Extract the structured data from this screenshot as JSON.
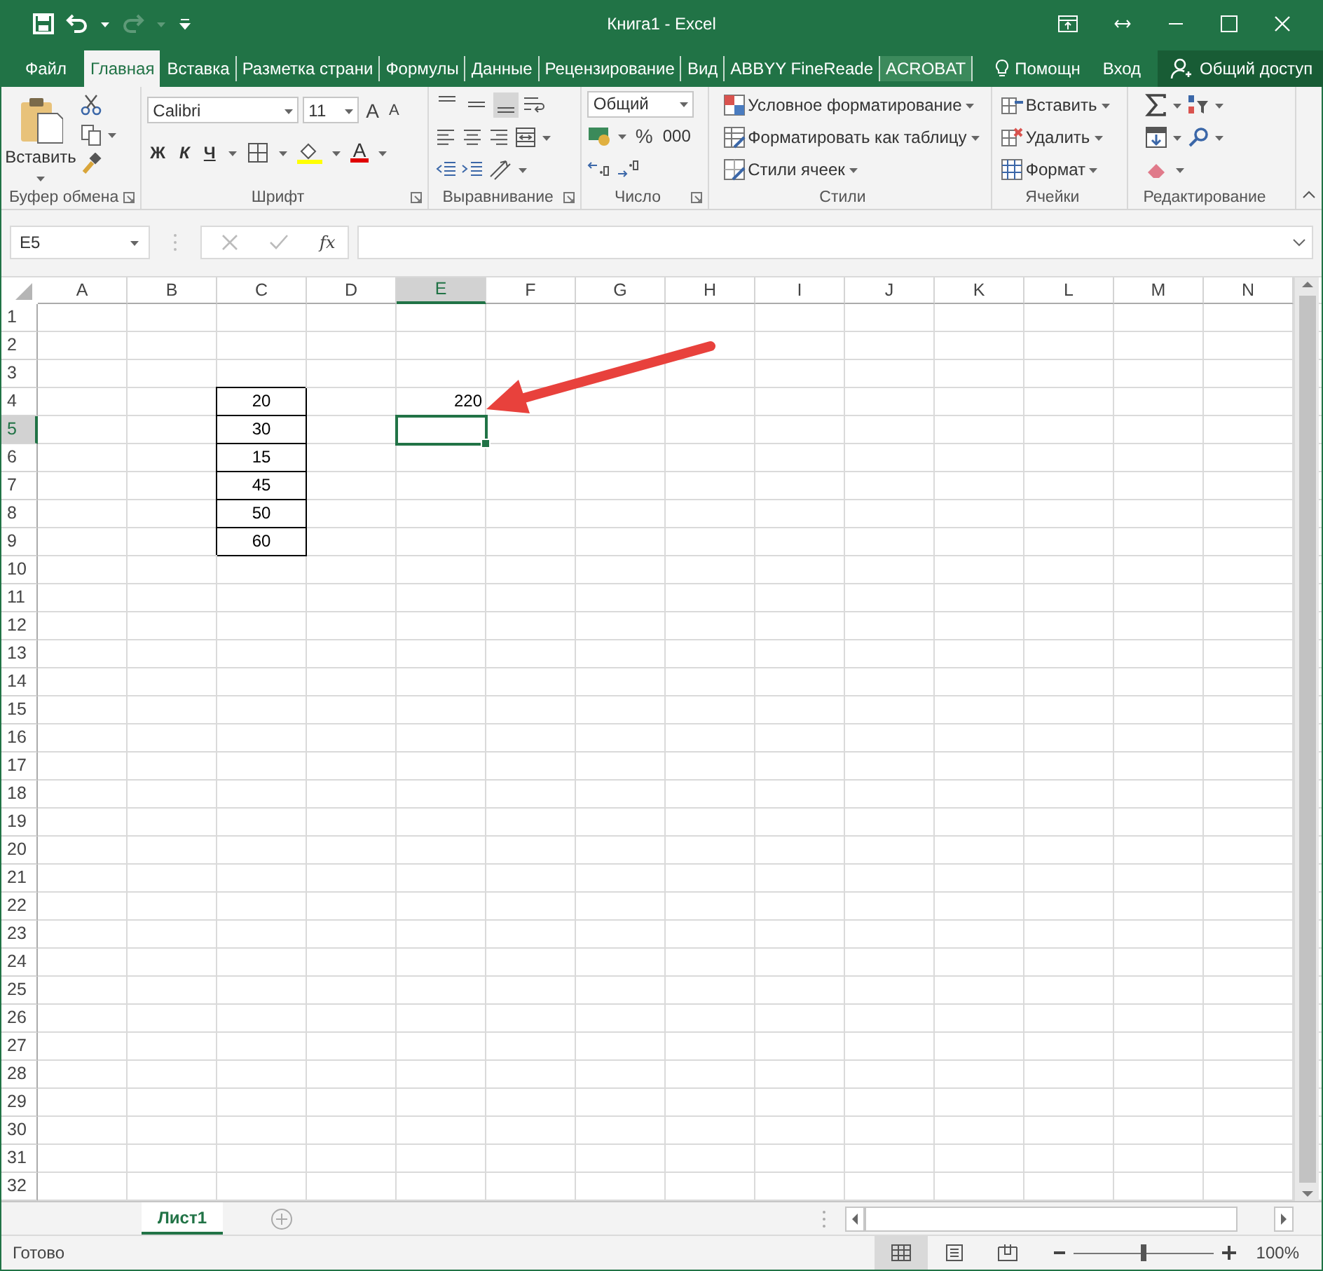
{
  "title_bar": {
    "title": "Книга1 - Excel"
  },
  "ribbon_tabs": [
    {
      "label": "Файл",
      "selected": false,
      "hovered": false
    },
    {
      "label": "Главная",
      "selected": true,
      "hovered": false
    },
    {
      "label": "Вставка",
      "selected": false,
      "hovered": false
    },
    {
      "label": "Разметка страни",
      "selected": false,
      "hovered": false
    },
    {
      "label": "Формулы",
      "selected": false,
      "hovered": false
    },
    {
      "label": "Данные",
      "selected": false,
      "hovered": false
    },
    {
      "label": "Рецензирование",
      "selected": false,
      "hovered": false
    },
    {
      "label": "Вид",
      "selected": false,
      "hovered": false
    },
    {
      "label": "ABBYY FineReade",
      "selected": false,
      "hovered": false
    },
    {
      "label": "ACROBAT",
      "selected": false,
      "hovered": true
    }
  ],
  "tell_me": {
    "label": "Помощн"
  },
  "sign_in": {
    "label": "Вход"
  },
  "share": {
    "label": "Общий доступ"
  },
  "ribbon": {
    "groups": [
      {
        "kind": "clipboard",
        "label": "Буфер обмена",
        "paste": "Вставить"
      },
      {
        "kind": "font",
        "label": "Шрифт",
        "font_name": "Calibri",
        "font_size": "11",
        "grow": "A",
        "shrink": "A",
        "bold": "Ж",
        "italic": "К",
        "underline": "Ч",
        "font_color": "A"
      },
      {
        "kind": "alignment",
        "label": "Выравнивание"
      },
      {
        "kind": "number",
        "label": "Число",
        "format": "Общий",
        "percent": "%",
        "thousands": "000"
      },
      {
        "kind": "styles",
        "label": "Стили",
        "items": [
          "Условное форматирование",
          "Форматировать как таблицу",
          "Стили ячеек"
        ]
      },
      {
        "kind": "cells",
        "label": "Ячейки",
        "items": [
          "Вставить",
          "Удалить",
          "Формат"
        ]
      },
      {
        "kind": "editing",
        "label": "Редактирование"
      }
    ]
  },
  "formula_bar": {
    "name_box": "E5",
    "function_label": "fx"
  },
  "sheet": {
    "columns": [
      {
        "label": "A",
        "selected": false
      },
      {
        "label": "B",
        "selected": false
      },
      {
        "label": "C",
        "selected": false
      },
      {
        "label": "D",
        "selected": false
      },
      {
        "label": "E",
        "selected": true
      },
      {
        "label": "F",
        "selected": false
      },
      {
        "label": "G",
        "selected": false
      },
      {
        "label": "H",
        "selected": false
      },
      {
        "label": "I",
        "selected": false
      },
      {
        "label": "J",
        "selected": false
      },
      {
        "label": "K",
        "selected": false
      },
      {
        "label": "L",
        "selected": false
      },
      {
        "label": "M",
        "selected": false
      },
      {
        "label": "N",
        "selected": false
      }
    ],
    "rows": [
      {
        "header": "1",
        "selected": false
      },
      {
        "header": "2",
        "selected": false
      },
      {
        "header": "3",
        "selected": false
      },
      {
        "header": "4",
        "selected": false,
        "cells": {
          "C": {
            "value": "20",
            "centered": true,
            "bordered": true
          },
          "E": {
            "value": "220",
            "centered": false,
            "bordered": false
          }
        }
      },
      {
        "header": "5",
        "selected": true,
        "cells": {
          "C": {
            "value": "30",
            "centered": true,
            "bordered": true
          },
          "E": {
            "selected": true
          }
        }
      },
      {
        "header": "6",
        "selected": false,
        "cells": {
          "C": {
            "value": "15",
            "centered": true,
            "bordered": true
          }
        }
      },
      {
        "header": "7",
        "selected": false,
        "cells": {
          "C": {
            "value": "45",
            "centered": true,
            "bordered": true
          }
        }
      },
      {
        "header": "8",
        "selected": false,
        "cells": {
          "C": {
            "value": "50",
            "centered": true,
            "bordered": true
          }
        }
      },
      {
        "header": "9",
        "selected": false,
        "cells": {
          "C": {
            "value": "60",
            "centered": true,
            "bordered": true
          }
        }
      },
      {
        "header": "10",
        "selected": false
      },
      {
        "header": "11",
        "selected": false
      },
      {
        "header": "12",
        "selected": false
      },
      {
        "header": "13",
        "selected": false
      },
      {
        "header": "14",
        "selected": false
      },
      {
        "header": "15",
        "selected": false
      },
      {
        "header": "16",
        "selected": false
      },
      {
        "header": "17",
        "selected": false
      },
      {
        "header": "18",
        "selected": false
      },
      {
        "header": "19",
        "selected": false
      },
      {
        "header": "20",
        "selected": false
      },
      {
        "header": "21",
        "selected": false
      },
      {
        "header": "22",
        "selected": false
      },
      {
        "header": "23",
        "selected": false
      },
      {
        "header": "24",
        "selected": false
      },
      {
        "header": "25",
        "selected": false
      },
      {
        "header": "26",
        "selected": false
      },
      {
        "header": "27",
        "selected": false
      },
      {
        "header": "28",
        "selected": false
      },
      {
        "header": "29",
        "selected": false
      },
      {
        "header": "30",
        "selected": false
      },
      {
        "header": "31",
        "selected": false
      },
      {
        "header": "32",
        "selected": false
      }
    ]
  },
  "sheet_tabs": [
    {
      "label": "Лист1",
      "selected": true
    }
  ],
  "status_bar": {
    "status": "Готово",
    "views": [
      {
        "kind": "normal",
        "selected": true
      },
      {
        "kind": "page_layout",
        "selected": false
      },
      {
        "kind": "page_break",
        "selected": false
      }
    ],
    "zoom_slider": {
      "level": 0.5
    },
    "zoom": "100%"
  }
}
